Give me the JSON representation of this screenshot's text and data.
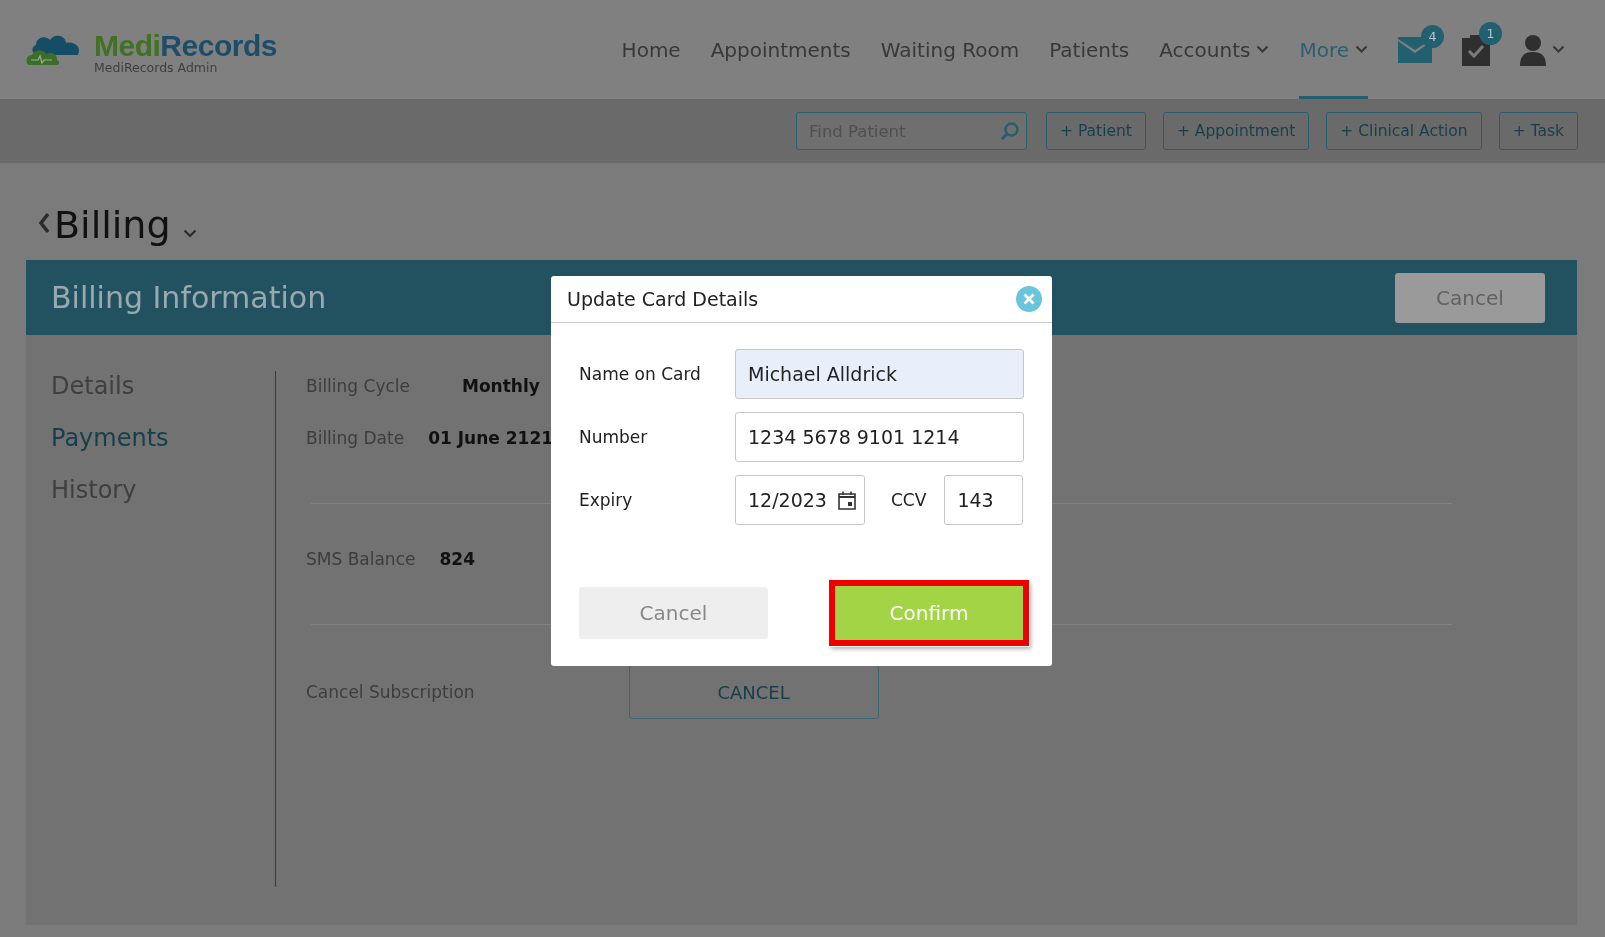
{
  "header": {
    "logo": {
      "wordmark": [
        "Medi",
        "Records"
      ],
      "subtitle": "MediRecords Admin"
    },
    "nav": [
      {
        "label": "Home",
        "selected": false,
        "kind": "link"
      },
      {
        "label": "Appointments",
        "selected": false,
        "kind": "link"
      },
      {
        "label": "Waiting Room",
        "selected": false,
        "kind": "link"
      },
      {
        "label": "Patients",
        "selected": false,
        "kind": "link"
      },
      {
        "label": "Accounts",
        "selected": false,
        "kind": "dropdown"
      },
      {
        "label": "More",
        "selected": true,
        "kind": "dropdown"
      }
    ],
    "icons": [
      {
        "kind": "mail",
        "badge": "4"
      },
      {
        "kind": "tasks",
        "badge": "1"
      },
      {
        "kind": "user"
      }
    ]
  },
  "toolbar": {
    "search": {
      "placeholder": "Find Patient"
    },
    "buttons": [
      "+ Patient",
      "+ Appointment",
      "+ Clinical Action",
      "+ Task"
    ]
  },
  "page_title": "Billing",
  "panel": {
    "title": "Billing Information",
    "cancel_button": "Cancel",
    "sidebar": [
      {
        "label": "Details",
        "selected": false
      },
      {
        "label": "Payments",
        "selected": true
      },
      {
        "label": "History",
        "selected": false
      }
    ],
    "sections": [
      {
        "rows": [
          {
            "label": "Billing Cycle",
            "value": "Monthly"
          },
          {
            "label": "Billing Date",
            "value": "01 June 2121"
          }
        ]
      },
      {
        "rows": [
          {
            "label": "SMS Balance",
            "value": "824"
          }
        ]
      },
      {
        "rows": [
          {
            "label": "Cancel Subscription",
            "button": "CANCEL"
          }
        ]
      }
    ]
  },
  "dialog": {
    "title": "Update Card Details",
    "name_on_card": {
      "label": "Name on Card",
      "value": "Michael Alldrick",
      "autofilled": true
    },
    "number": {
      "label": "Number",
      "value": "1234 5678 9101 1214",
      "autofilled": false
    },
    "expiry": {
      "label": "Expiry",
      "value": "12/2023"
    },
    "ccv": {
      "label": "CCV",
      "value": "143"
    },
    "cancel_button": "Cancel",
    "confirm_button": {
      "label": "Confirm",
      "highlighted": true
    }
  }
}
